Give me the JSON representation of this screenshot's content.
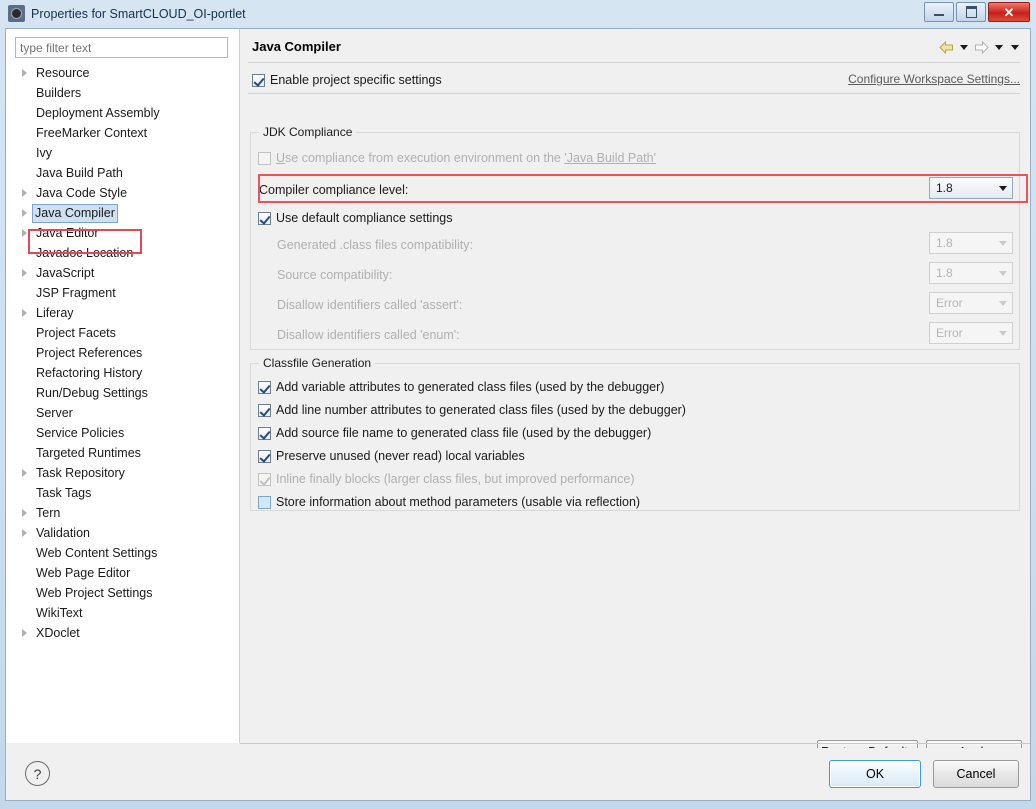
{
  "window": {
    "title": "Properties for SmartCLOUD_OI-portlet",
    "icon": "properties-dialog-icon",
    "controls": {
      "minimize": "minimize-button",
      "maximize": "maximize-button",
      "close_glyph": "✕"
    }
  },
  "sidebar": {
    "filter": {
      "placeholder": "type filter text",
      "value": ""
    },
    "items": [
      {
        "label": "Resource",
        "expandable": true,
        "selected": false
      },
      {
        "label": "Builders",
        "expandable": false,
        "selected": false
      },
      {
        "label": "Deployment Assembly",
        "expandable": false,
        "selected": false
      },
      {
        "label": "FreeMarker Context",
        "expandable": false,
        "selected": false
      },
      {
        "label": "Ivy",
        "expandable": false,
        "selected": false
      },
      {
        "label": "Java Build Path",
        "expandable": false,
        "selected": false
      },
      {
        "label": "Java Code Style",
        "expandable": true,
        "selected": false
      },
      {
        "label": "Java Compiler",
        "expandable": true,
        "selected": true
      },
      {
        "label": "Java Editor",
        "expandable": true,
        "selected": false
      },
      {
        "label": "Javadoc Location",
        "expandable": false,
        "selected": false
      },
      {
        "label": "JavaScript",
        "expandable": true,
        "selected": false
      },
      {
        "label": "JSP Fragment",
        "expandable": false,
        "selected": false
      },
      {
        "label": "Liferay",
        "expandable": true,
        "selected": false
      },
      {
        "label": "Project Facets",
        "expandable": false,
        "selected": false
      },
      {
        "label": "Project References",
        "expandable": false,
        "selected": false
      },
      {
        "label": "Refactoring History",
        "expandable": false,
        "selected": false
      },
      {
        "label": "Run/Debug Settings",
        "expandable": false,
        "selected": false
      },
      {
        "label": "Server",
        "expandable": false,
        "selected": false
      },
      {
        "label": "Service Policies",
        "expandable": false,
        "selected": false
      },
      {
        "label": "Targeted Runtimes",
        "expandable": false,
        "selected": false
      },
      {
        "label": "Task Repository",
        "expandable": true,
        "selected": false
      },
      {
        "label": "Task Tags",
        "expandable": false,
        "selected": false
      },
      {
        "label": "Tern",
        "expandable": true,
        "selected": false
      },
      {
        "label": "Validation",
        "expandable": true,
        "selected": false
      },
      {
        "label": "Web Content Settings",
        "expandable": false,
        "selected": false
      },
      {
        "label": "Web Page Editor",
        "expandable": false,
        "selected": false
      },
      {
        "label": "Web Project Settings",
        "expandable": false,
        "selected": false
      },
      {
        "label": "WikiText",
        "expandable": false,
        "selected": false
      },
      {
        "label": "XDoclet",
        "expandable": true,
        "selected": false
      }
    ]
  },
  "page": {
    "title": "Java Compiler",
    "nav": {
      "back_icon": "back-arrow-icon",
      "back_dropdown_icon": "caret-down-icon",
      "forward_icon": "forward-arrow-icon",
      "forward_dropdown_icon": "caret-down-icon",
      "menu_icon": "caret-down-icon"
    },
    "enable_project_specific": {
      "label": "Enable project specific settings",
      "checked": true
    },
    "configure_workspace_link": "Configure Workspace Settings...",
    "jdk_compliance": {
      "group_title": "JDK Compliance",
      "use_execution_env": {
        "label_prefix": "U",
        "label": "se compliance from execution environment on the ",
        "link": "'Java Build Path'",
        "checked": false,
        "disabled": true
      },
      "compliance_level": {
        "label": "Compiler compliance level:",
        "value": "1.8",
        "highlighted": true
      },
      "use_default_settings": {
        "label": "Use default compliance settings",
        "checked": true
      },
      "rows": [
        {
          "label": "Generated .class files compatibility:",
          "value": "1.8",
          "disabled": true
        },
        {
          "label": "Source compatibility:",
          "value": "1.8",
          "disabled": true
        },
        {
          "label": "Disallow identifiers called 'assert':",
          "value": "Error",
          "disabled": true
        },
        {
          "label": "Disallow identifiers called 'enum':",
          "value": "Error",
          "disabled": true
        }
      ]
    },
    "classfile_generation": {
      "group_title": "Classfile Generation",
      "options": [
        {
          "label": "Add variable attributes to generated class files (used by the debugger)",
          "checked": true,
          "disabled": false,
          "style": "normal"
        },
        {
          "label": "Add line number attributes to generated class files (used by the debugger)",
          "checked": true,
          "disabled": false,
          "style": "normal"
        },
        {
          "label": "Add source file name to generated class file (used by the debugger)",
          "checked": true,
          "disabled": false,
          "style": "normal"
        },
        {
          "label": "Preserve unused (never read) local variables",
          "checked": true,
          "disabled": false,
          "style": "normal"
        },
        {
          "label": "Inline finally blocks (larger class files, but improved performance)",
          "checked": true,
          "disabled": true,
          "style": "dim"
        },
        {
          "label": "Store information about method parameters (usable via reflection)",
          "checked": false,
          "disabled": false,
          "style": "blue"
        }
      ]
    }
  },
  "buttons": {
    "restore_defaults": "Restore Defaults",
    "apply": "Apply",
    "ok": "OK",
    "cancel": "Cancel",
    "help_glyph": "?"
  },
  "colors": {
    "highlight_red": "#e8545c",
    "selection_blue": "#cfe0f2",
    "title_bar": "#d6e5f2",
    "close_button": "#c6201a"
  }
}
